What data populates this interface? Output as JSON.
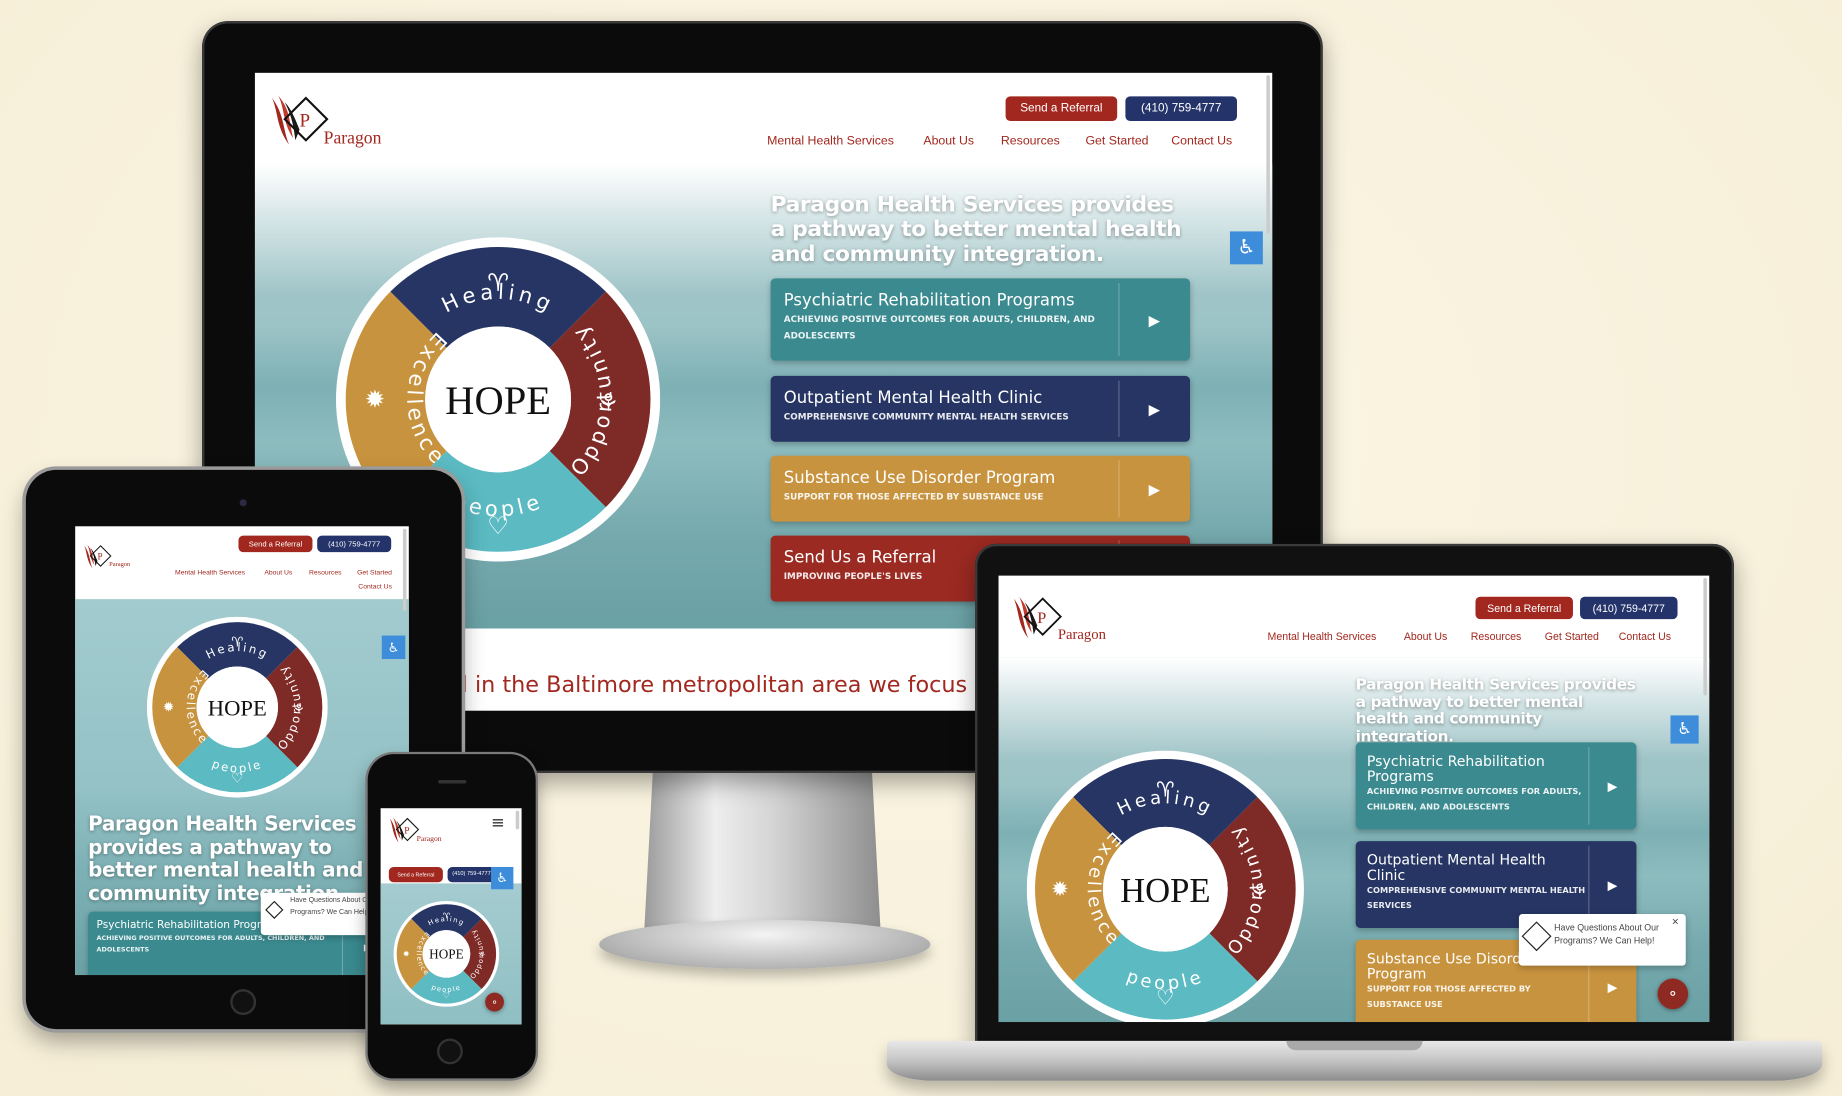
{
  "site": {
    "brand": "Paragon",
    "logo_letter": "P",
    "buttons": {
      "referral": "Send a Referral",
      "phone": "(410) 759-4777"
    },
    "nav": [
      "Mental Health Services",
      "About Us",
      "Resources",
      "Get Started",
      "Contact Us"
    ],
    "headline": "Paragon Health Services provides a pathway to better mental health and community integration.",
    "cards": [
      {
        "title": "Psychiatric Rehabilitation Programs",
        "subtitle": "Achieving positive outcomes for adults, children, and adolescents",
        "color": "#3a8a8f"
      },
      {
        "title": "Outpatient Mental Health Clinic",
        "subtitle": "Comprehensive community mental health services",
        "color": "#263564"
      },
      {
        "title": "Substance Use Disorder Program",
        "subtitle": "Support for those affected by substance use",
        "color": "#c8933e"
      },
      {
        "title": "Send Us a Referral",
        "subtitle": "Improving people's lives",
        "color": "#9b2a22"
      }
    ],
    "wheel": {
      "center": "HOPE",
      "segments": [
        {
          "label": "Healing",
          "color": "#263564",
          "icon": "hands-icon"
        },
        {
          "label": "Opportunity",
          "color": "#7e2a27",
          "icon": "hand-plant-icon"
        },
        {
          "label": "people",
          "color": "#5bbac2",
          "icon": "heart-hands-icon"
        },
        {
          "label": "Excellence",
          "color": "#c8933e",
          "icon": "badge-star-icon"
        }
      ]
    },
    "chat": {
      "message": "Have Questions About Our Programs? We Can Help!",
      "close": "×"
    },
    "intro_fragment": "l in the Baltimore metropolitan area we focus",
    "play_icon": "▶",
    "access_icon": "♿",
    "menu_icon": "≡"
  },
  "colors": {
    "background": "#f8f1dc",
    "brand_red": "#a2281f",
    "brand_navy": "#24336a",
    "accessibility_blue": "#3d8ddb"
  }
}
